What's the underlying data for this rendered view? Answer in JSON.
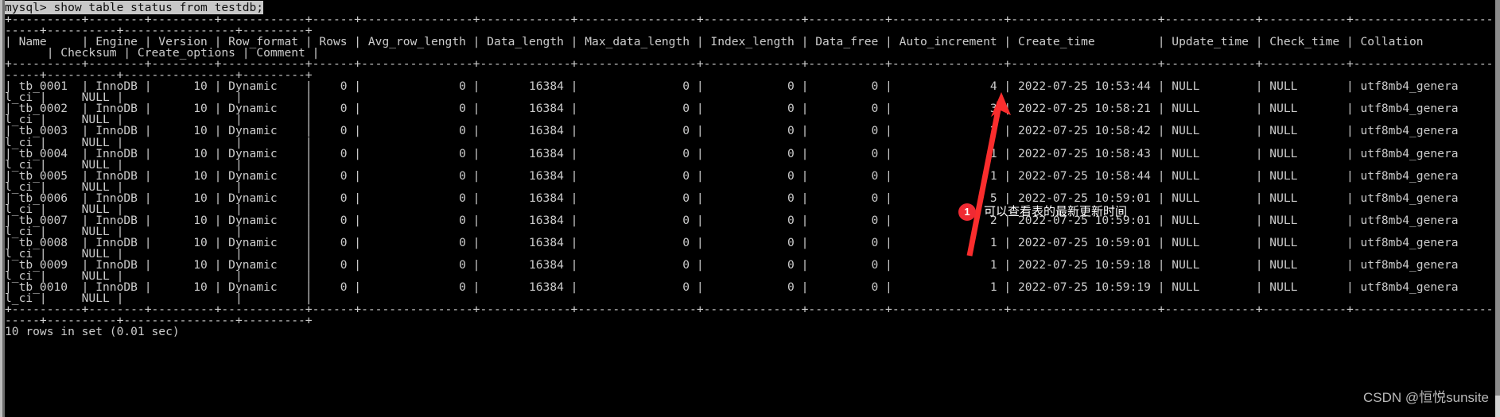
{
  "terminal": {
    "prompt_line": "mysql> show table status from testdb;",
    "rule_top_a": "+----------+--------+---------+------------+------+----------------+-------------+-----------------+--------------+-----------+----------------+---------------------+-------------+------------+--------------------",
    "rule_top_b": "-----+----------+----------------+---------+",
    "header_a": "| Name     | Engine | Version | Row_format | Rows | Avg_row_length | Data_length | Max_data_length | Index_length | Data_free | Auto_increment | Create_time         | Update_time | Check_time | Collation",
    "header_b": "      | Checksum | Create_options | Comment |",
    "rule_mid_a": "+----------+--------+---------+------------+------+----------------+-------------+-----------------+--------------+-----------+----------------+---------------------+-------------+------------+--------------------",
    "rule_mid_b": "-----+----------+----------------+---------+",
    "rule_bottom_a": "+----------+--------+---------+------------+------+----------------+-------------+-----------------+--------------+-----------+----------------+---------------------+-------------+------------+--------------------",
    "rule_bottom_b": "-----+----------+----------------+---------+",
    "footer": "10 rows in set (0.01 sec)",
    "columns": [
      "Name",
      "Engine",
      "Version",
      "Row_format",
      "Rows",
      "Avg_row_length",
      "Data_length",
      "Max_data_length",
      "Index_length",
      "Data_free",
      "Auto_increment",
      "Create_time",
      "Update_time",
      "Check_time",
      "Collation",
      "Checksum",
      "Create_options",
      "Comment"
    ],
    "rows": [
      {
        "line_a": "| tb_0001  | InnoDB |      10 | Dynamic    |    0 |              0 |       16384 |               0 |            0 |         0 |              4 | 2022-07-25 10:53:44 | NULL        | NULL       | utf8mb4_genera",
        "line_b": "l_ci |     NULL |                |         |",
        "name": "tb_0001",
        "engine": "InnoDB",
        "version": "10",
        "row_format": "Dynamic",
        "rows": "0",
        "avg_row_length": "0",
        "data_length": "16384",
        "max_data_length": "0",
        "index_length": "0",
        "data_free": "0",
        "auto_increment": "4",
        "create_time": "2022-07-25 10:53:44",
        "update_time": "NULL",
        "check_time": "NULL",
        "collation": "utf8mb4_general_ci",
        "checksum": "NULL",
        "create_options": "",
        "comment": ""
      },
      {
        "line_a": "| tb_0002  | InnoDB |      10 | Dynamic    |    0 |              0 |       16384 |               0 |            0 |         0 |              3 | 2022-07-25 10:58:21 | NULL        | NULL       | utf8mb4_genera",
        "line_b": "l_ci |     NULL |                |         |",
        "name": "tb_0002",
        "engine": "InnoDB",
        "version": "10",
        "row_format": "Dynamic",
        "rows": "0",
        "avg_row_length": "0",
        "data_length": "16384",
        "max_data_length": "0",
        "index_length": "0",
        "data_free": "0",
        "auto_increment": "3",
        "create_time": "2022-07-25 10:58:21",
        "update_time": "NULL",
        "check_time": "NULL",
        "collation": "utf8mb4_general_ci",
        "checksum": "NULL",
        "create_options": "",
        "comment": ""
      },
      {
        "line_a": "| tb_0003  | InnoDB |      10 | Dynamic    |    0 |              0 |       16384 |               0 |            0 |         0 |              2 | 2022-07-25 10:58:42 | NULL        | NULL       | utf8mb4_genera",
        "line_b": "l_ci |     NULL |                |         |",
        "name": "tb_0003",
        "engine": "InnoDB",
        "version": "10",
        "row_format": "Dynamic",
        "rows": "0",
        "avg_row_length": "0",
        "data_length": "16384",
        "max_data_length": "0",
        "index_length": "0",
        "data_free": "0",
        "auto_increment": "2",
        "create_time": "2022-07-25 10:58:42",
        "update_time": "NULL",
        "check_time": "NULL",
        "collation": "utf8mb4_general_ci",
        "checksum": "NULL",
        "create_options": "",
        "comment": ""
      },
      {
        "line_a": "| tb_0004  | InnoDB |      10 | Dynamic    |    0 |              0 |       16384 |               0 |            0 |         0 |              1 | 2022-07-25 10:58:43 | NULL        | NULL       | utf8mb4_genera",
        "line_b": "l_ci |     NULL |                |         |",
        "name": "tb_0004",
        "engine": "InnoDB",
        "version": "10",
        "row_format": "Dynamic",
        "rows": "0",
        "avg_row_length": "0",
        "data_length": "16384",
        "max_data_length": "0",
        "index_length": "0",
        "data_free": "0",
        "auto_increment": "1",
        "create_time": "2022-07-25 10:58:43",
        "update_time": "NULL",
        "check_time": "NULL",
        "collation": "utf8mb4_general_ci",
        "checksum": "NULL",
        "create_options": "",
        "comment": ""
      },
      {
        "line_a": "| tb_0005  | InnoDB |      10 | Dynamic    |    0 |              0 |       16384 |               0 |            0 |         0 |              1 | 2022-07-25 10:58:44 | NULL        | NULL       | utf8mb4_genera",
        "line_b": "l_ci |     NULL |                |         |",
        "name": "tb_0005",
        "engine": "InnoDB",
        "version": "10",
        "row_format": "Dynamic",
        "rows": "0",
        "avg_row_length": "0",
        "data_length": "16384",
        "max_data_length": "0",
        "index_length": "0",
        "data_free": "0",
        "auto_increment": "1",
        "create_time": "2022-07-25 10:58:44",
        "update_time": "NULL",
        "check_time": "NULL",
        "collation": "utf8mb4_general_ci",
        "checksum": "NULL",
        "create_options": "",
        "comment": ""
      },
      {
        "line_a": "| tb_0006  | InnoDB |      10 | Dynamic    |    0 |              0 |       16384 |               0 |            0 |         0 |              5 | 2022-07-25 10:59:01 | NULL        | NULL       | utf8mb4_genera",
        "line_b": "l_ci |     NULL |                |         |",
        "name": "tb_0006",
        "engine": "InnoDB",
        "version": "10",
        "row_format": "Dynamic",
        "rows": "0",
        "avg_row_length": "0",
        "data_length": "16384",
        "max_data_length": "0",
        "index_length": "0",
        "data_free": "0",
        "auto_increment": "5",
        "create_time": "2022-07-25 10:59:01",
        "update_time": "NULL",
        "check_time": "NULL",
        "collation": "utf8mb4_general_ci",
        "checksum": "NULL",
        "create_options": "",
        "comment": ""
      },
      {
        "line_a": "| tb_0007  | InnoDB |      10 | Dynamic    |    0 |              0 |       16384 |               0 |            0 |         0 |              2 | 2022-07-25 10:59:01 | NULL        | NULL       | utf8mb4_genera",
        "line_b": "l_ci |     NULL |                |         |",
        "name": "tb_0007",
        "engine": "InnoDB",
        "version": "10",
        "row_format": "Dynamic",
        "rows": "0",
        "avg_row_length": "0",
        "data_length": "16384",
        "max_data_length": "0",
        "index_length": "0",
        "data_free": "0",
        "auto_increment": "2",
        "create_time": "2022-07-25 10:59:01",
        "update_time": "NULL",
        "check_time": "NULL",
        "collation": "utf8mb4_general_ci",
        "checksum": "NULL",
        "create_options": "",
        "comment": ""
      },
      {
        "line_a": "| tb_0008  | InnoDB |      10 | Dynamic    |    0 |              0 |       16384 |               0 |            0 |         0 |              1 | 2022-07-25 10:59:01 | NULL        | NULL       | utf8mb4_genera",
        "line_b": "l_ci |     NULL |                |         |",
        "name": "tb_0008",
        "engine": "InnoDB",
        "version": "10",
        "row_format": "Dynamic",
        "rows": "0",
        "avg_row_length": "0",
        "data_length": "16384",
        "max_data_length": "0",
        "index_length": "0",
        "data_free": "0",
        "auto_increment": "1",
        "create_time": "2022-07-25 10:59:01",
        "update_time": "NULL",
        "check_time": "NULL",
        "collation": "utf8mb4_general_ci",
        "checksum": "NULL",
        "create_options": "",
        "comment": ""
      },
      {
        "line_a": "| tb_0009  | InnoDB |      10 | Dynamic    |    0 |              0 |       16384 |               0 |            0 |         0 |              1 | 2022-07-25 10:59:18 | NULL        | NULL       | utf8mb4_genera",
        "line_b": "l_ci |     NULL |                |         |",
        "name": "tb_0009",
        "engine": "InnoDB",
        "version": "10",
        "row_format": "Dynamic",
        "rows": "0",
        "avg_row_length": "0",
        "data_length": "16384",
        "max_data_length": "0",
        "index_length": "0",
        "data_free": "0",
        "auto_increment": "1",
        "create_time": "2022-07-25 10:59:18",
        "update_time": "NULL",
        "check_time": "NULL",
        "collation": "utf8mb4_general_ci",
        "checksum": "NULL",
        "create_options": "",
        "comment": ""
      },
      {
        "line_a": "| tb_0010  | InnoDB |      10 | Dynamic    |    0 |              0 |       16384 |               0 |            0 |         0 |              1 | 2022-07-25 10:59:19 | NULL        | NULL       | utf8mb4_genera",
        "line_b": "l_ci |     NULL |                |         |",
        "name": "tb_0010",
        "engine": "InnoDB",
        "version": "10",
        "row_format": "Dynamic",
        "rows": "0",
        "avg_row_length": "0",
        "data_length": "16384",
        "max_data_length": "0",
        "index_length": "0",
        "data_free": "0",
        "auto_increment": "1",
        "create_time": "2022-07-25 10:59:19",
        "update_time": "NULL",
        "check_time": "NULL",
        "collation": "utf8mb4_general_ci",
        "checksum": "NULL",
        "create_options": "",
        "comment": ""
      }
    ]
  },
  "annotation": {
    "badge_label": "1",
    "text": "可以查看表的最新更新时间",
    "arrow_color": "#fa2d2d",
    "badge_color": "#f02a33"
  },
  "watermark": {
    "text": "CSDN @恒悦sunsite"
  }
}
